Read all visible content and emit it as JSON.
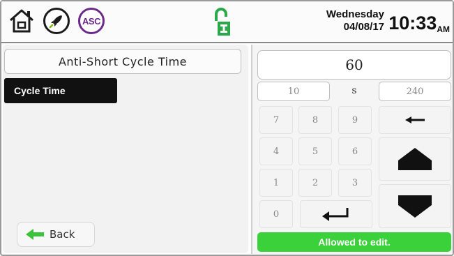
{
  "header": {
    "icons": [
      "home-icon",
      "rocket-icon",
      "asc-icon",
      "lock-icon"
    ],
    "asc_label": "ASC",
    "day": "Wednesday",
    "date": "04/08/17",
    "time": "10:33",
    "ampm": "AM"
  },
  "left": {
    "title": "Anti-Short Cycle Time",
    "items": [
      {
        "label": "Cycle Time",
        "selected": true
      }
    ],
    "back_label": "Back"
  },
  "editor": {
    "value": "60",
    "min": "10",
    "unit": "s",
    "max": "240",
    "keys": [
      "7",
      "8",
      "9",
      "4",
      "5",
      "6",
      "1",
      "2",
      "3",
      "0"
    ],
    "backspace_icon": "arrow-left-icon",
    "enter_icon": "enter-icon",
    "up_icon": "triangle-up-icon",
    "down_icon": "triangle-down-icon",
    "status": "Allowed to edit.",
    "status_color": "#3bd13b"
  }
}
